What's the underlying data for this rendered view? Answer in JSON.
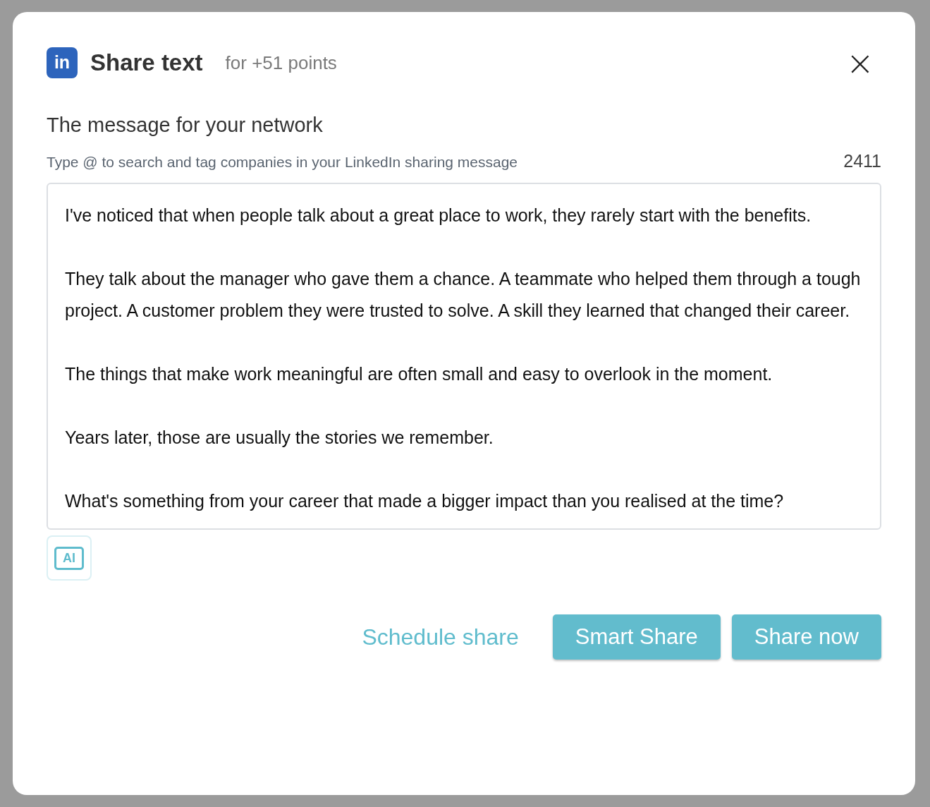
{
  "dialog": {
    "logo_text": "in",
    "title": "Share text",
    "subtitle": "for +51 points",
    "close": "×"
  },
  "message": {
    "label": "The message for your network",
    "hint": "Type @ to search and tag companies in your LinkedIn sharing message",
    "count": "2411",
    "paragraphs": [
      "I've noticed that when people talk about a great place to work, they rarely start with the benefits.",
      "They talk about the manager who gave them a chance. A teammate who helped them through a tough project. A customer problem they were trusted to solve. A skill they learned that changed their career.",
      "The things that make work meaningful are often small and easy to overlook in the moment.",
      "Years later, those are usually the stories we remember.",
      "What's something from your career that made a bigger impact than you realised at the time?"
    ]
  },
  "ai_button": {
    "label": "AI"
  },
  "actions": [
    {
      "label": "Schedule share",
      "kind": "link"
    },
    {
      "label": "Smart Share",
      "kind": "button"
    },
    {
      "label": "Share now",
      "kind": "button"
    }
  ]
}
